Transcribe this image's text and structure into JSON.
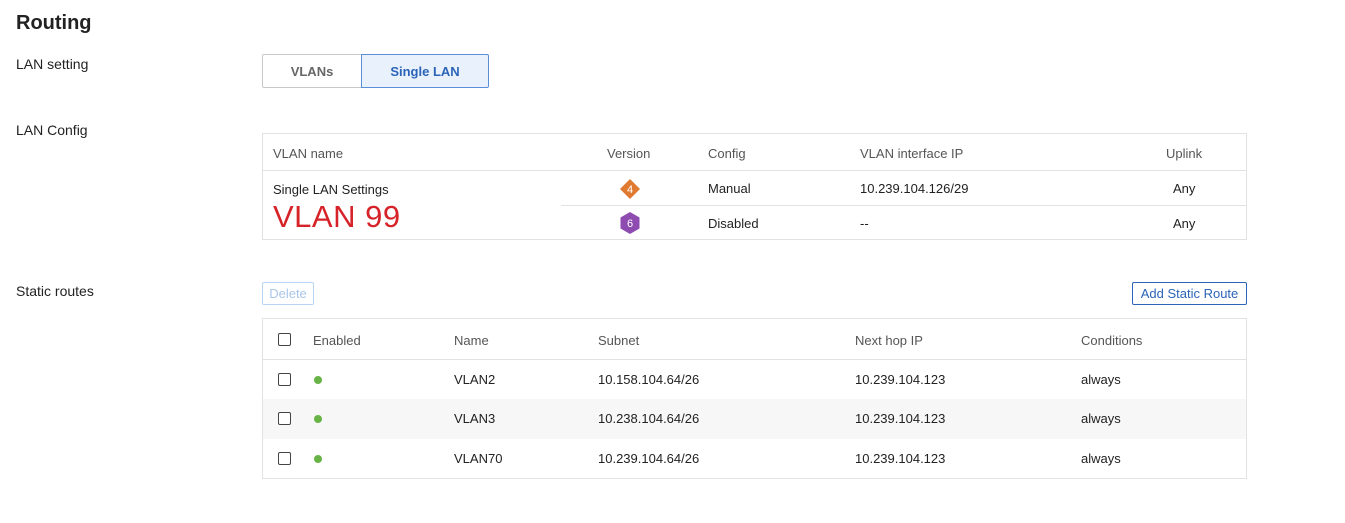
{
  "page": {
    "title": "Routing"
  },
  "lan_setting": {
    "label": "LAN setting",
    "options": [
      "VLANs",
      "Single LAN"
    ],
    "selected": "Single LAN"
  },
  "lan_config": {
    "label": "LAN Config",
    "headers": {
      "vlan_name": "VLAN name",
      "version": "Version",
      "config": "Config",
      "ip": "VLAN interface IP",
      "uplink": "Uplink"
    },
    "name": "Single LAN Settings",
    "vlan_callout": "VLAN 99",
    "rows": [
      {
        "version": "4",
        "version_icon": "ipv4-diamond-icon",
        "config": "Manual",
        "ip": "10.239.104.126/29",
        "uplink": "Any"
      },
      {
        "version": "6",
        "version_icon": "ipv6-hexagon-icon",
        "config": "Disabled",
        "ip": "--",
        "uplink": "Any"
      }
    ]
  },
  "static_routes": {
    "label": "Static routes",
    "delete_label": "Delete",
    "add_label": "Add Static Route",
    "headers": {
      "enabled": "Enabled",
      "name": "Name",
      "subnet": "Subnet",
      "next_hop": "Next hop IP",
      "conditions": "Conditions"
    },
    "rows": [
      {
        "enabled": true,
        "name": "VLAN2",
        "subnet": "10.158.104.64/26",
        "next_hop": "10.239.104.123",
        "conditions": "always"
      },
      {
        "enabled": true,
        "name": "VLAN3",
        "subnet": "10.238.104.64/26",
        "next_hop": "10.239.104.123",
        "conditions": "always"
      },
      {
        "enabled": true,
        "name": "VLAN70",
        "subnet": "10.239.104.64/26",
        "next_hop": "10.239.104.123",
        "conditions": "always"
      }
    ]
  },
  "colors": {
    "accent": "#2b64b8",
    "callout": "#d6232a",
    "ipv4": "#e07a30",
    "ipv6": "#8e4bb0",
    "enabled": "#67b346"
  }
}
